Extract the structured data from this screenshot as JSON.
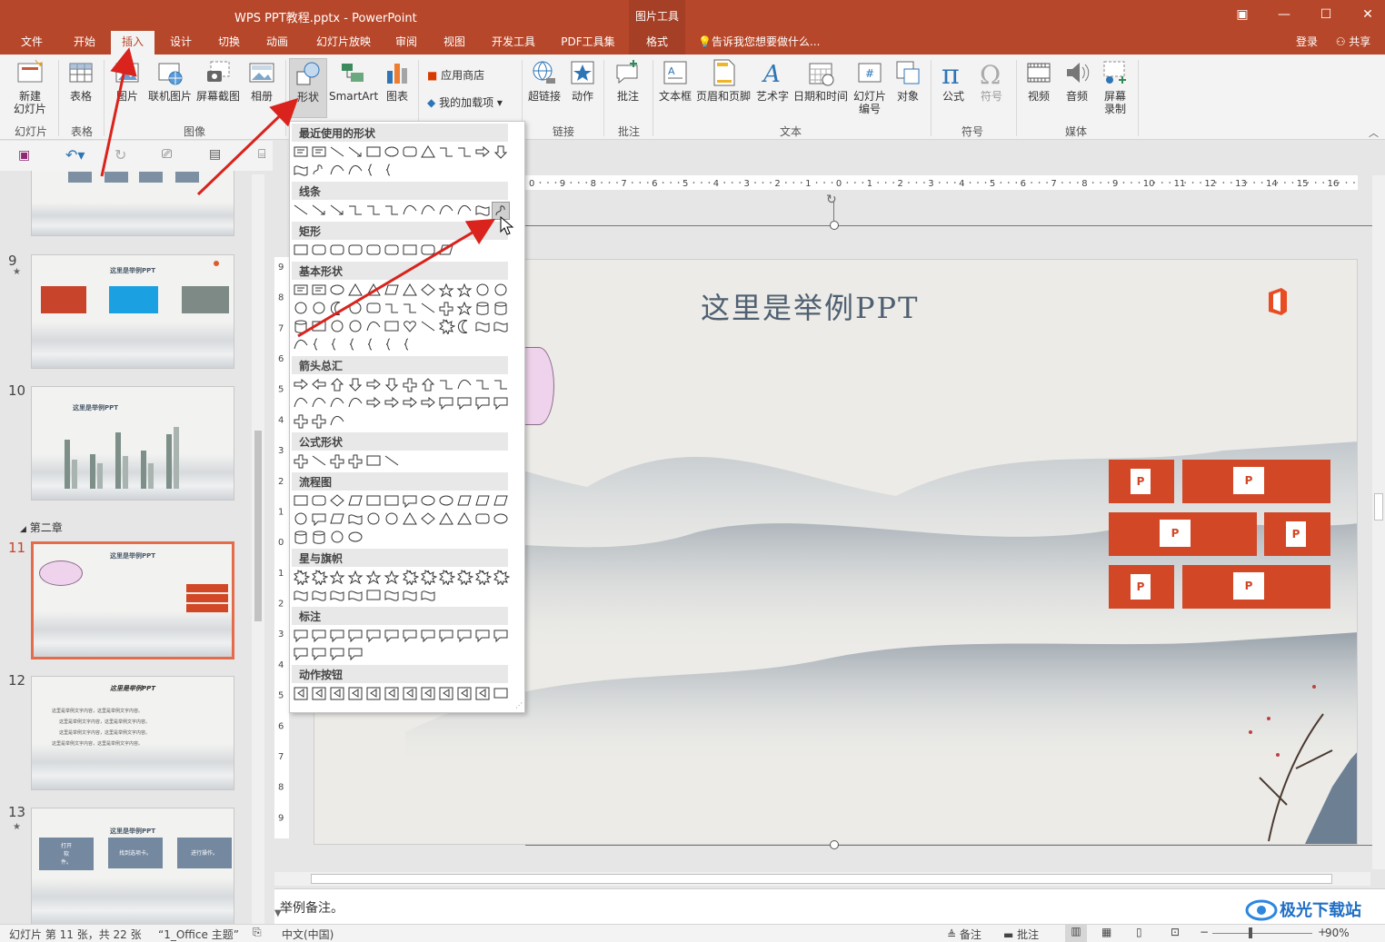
{
  "app": {
    "title": "WPS PPT教程.pptx - PowerPoint",
    "context_tab_group": "图片工具",
    "window_controls": [
      "ribbon-display-icon",
      "minimize-icon",
      "maximize-icon",
      "close-icon"
    ]
  },
  "tabs": {
    "file": "文件",
    "home": "开始",
    "insert": "插入",
    "design": "设计",
    "transitions": "切换",
    "animations": "动画",
    "slideshow": "幻灯片放映",
    "review": "审阅",
    "view": "视图",
    "developer": "开发工具",
    "pdf": "PDF工具集",
    "format": "格式",
    "tellme": "告诉我您想要做什么...",
    "signin": "登录",
    "share": "共享"
  },
  "ribbon": {
    "new_slide": "新建\n幻灯片",
    "table": "表格",
    "picture": "图片",
    "online_picture": "联机图片",
    "screenshot": "屏幕截图",
    "album": "相册",
    "shapes": "形状",
    "smartart": "SmartArt",
    "chart": "图表",
    "store": "应用商店",
    "my_addins": "我的加载项",
    "hyperlink": "超链接",
    "action": "动作",
    "comment": "批注",
    "textbox": "文本框",
    "header_footer": "页眉和页脚",
    "wordart": "艺术字",
    "datetime": "日期和时间",
    "slide_number": "幻灯片\n编号",
    "object": "对象",
    "equation": "公式",
    "symbol": "符号",
    "video": "视频",
    "audio": "音频",
    "screen_recording": "屏幕\n录制",
    "groups": {
      "slides": "幻灯片",
      "tables": "表格",
      "images": "图像",
      "links": "链接",
      "comments": "批注",
      "text": "文本",
      "symbols": "符号",
      "media": "媒体"
    }
  },
  "shape_gallery": {
    "recent": "最近使用的形状",
    "lines": "线条",
    "rectangles": "矩形",
    "basic": "基本形状",
    "arrows": "箭头总汇",
    "equation": "公式形状",
    "flowchart": "流程图",
    "stars": "星与旗帜",
    "callouts": "标注",
    "action_buttons": "动作按钮"
  },
  "slides_panel": {
    "section": "第二章",
    "numbers": {
      "s9": "9",
      "s10": "10",
      "s11": "11",
      "s12": "12",
      "s13": "13"
    },
    "thumb_title": "这里是举例PPT",
    "s13_boxes": [
      "打开\n软\n件。",
      "找到选项卡。",
      "进行操作。"
    ],
    "s12_lines": [
      "这里是举例文字内容，这里是举例文字内容。",
      "这里是举例文字内容，这里是举例文字内容。",
      "这里是举例文字内容，这里是举例文字内容。",
      "这里是举例文字内容，这里是举例文字内容。"
    ]
  },
  "slide": {
    "title": "这里是举例PPT"
  },
  "ruler_top": [
    "0",
    "9",
    "8",
    "7",
    "6",
    "5",
    "4",
    "3",
    "2",
    "1",
    "0",
    "1",
    "2",
    "3",
    "4",
    "5",
    "6",
    "7",
    "8",
    "9",
    "10",
    "11",
    "12",
    "13",
    "14",
    "15",
    "16"
  ],
  "ruler_left": [
    "9",
    "8",
    "7",
    "6",
    "5",
    "4",
    "3",
    "2",
    "1",
    "0",
    "1",
    "2",
    "3",
    "4",
    "5",
    "6",
    "7",
    "8",
    "9"
  ],
  "notes": {
    "text": "举例备注。"
  },
  "status": {
    "slide_info": "幻灯片 第 11 张，共 22 张",
    "theme": "“1_Office 主题”",
    "language": "中文(中国)",
    "notes": "备注",
    "comments": "批注",
    "zoom": "90%"
  },
  "watermark": "极光下载站"
}
